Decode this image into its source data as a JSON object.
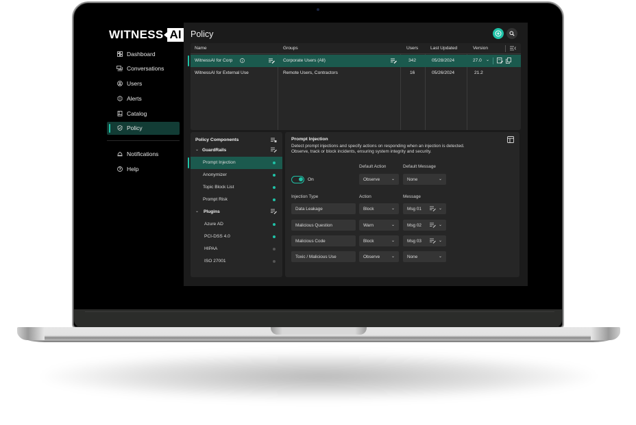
{
  "brand": {
    "word": "WITNESS",
    "box": "AI"
  },
  "sidebar": {
    "items": [
      {
        "label": "Dashboard",
        "icon": "dashboard-icon"
      },
      {
        "label": "Conversations",
        "icon": "conversations-icon"
      },
      {
        "label": "Users",
        "icon": "users-icon"
      },
      {
        "label": "Alerts",
        "icon": "alerts-icon"
      },
      {
        "label": "Catalog",
        "icon": "catalog-icon"
      },
      {
        "label": "Policy",
        "icon": "policy-shield-icon",
        "active": true
      }
    ],
    "secondary": [
      {
        "label": "Notifications",
        "icon": "bell-icon"
      },
      {
        "label": "Help",
        "icon": "help-icon"
      }
    ]
  },
  "header": {
    "title": "Policy",
    "add_icon": "plus-circle-icon",
    "search_icon": "search-icon"
  },
  "colors": {
    "accent": "#1fc2a7",
    "selected_row": "#1b5a4e",
    "panel": "#262626",
    "background": "#1b1b1b"
  },
  "policy_table": {
    "columns": [
      "Name",
      "Groups",
      "Users",
      "Last Updated",
      "Version"
    ],
    "rows": [
      {
        "name": "WitnessAI for Corp",
        "groups": "Corporate Users (All)",
        "users": "342",
        "last_updated": "05/28/2024",
        "version": "27.0",
        "selected": true
      },
      {
        "name": "WitnessAI for External Use",
        "groups": "Remote Users, Contractors",
        "users": "16",
        "last_updated": "05/26/2024",
        "version": "21.2",
        "selected": false
      }
    ]
  },
  "components": {
    "title": "Policy Components",
    "groups": [
      {
        "label": "GuardRails",
        "items": [
          {
            "label": "Prompt Injection",
            "enabled": true,
            "selected": true
          },
          {
            "label": "Anonymizer",
            "enabled": true
          },
          {
            "label": "Topic Block List",
            "enabled": true
          },
          {
            "label": "Prompt Risk",
            "enabled": true
          }
        ]
      },
      {
        "label": "Plugins",
        "items": [
          {
            "label": "Azure AD",
            "enabled": true
          },
          {
            "label": "PCI-DSS 4.0",
            "enabled": true
          },
          {
            "label": "HIPAA",
            "enabled": false
          },
          {
            "label": "ISO 27001",
            "enabled": false
          }
        ]
      }
    ]
  },
  "detail": {
    "title": "Prompt Injection",
    "description": "Detect prompt injections and specify actions on responding when an injection is detected. Observe, track or block incidents, ensuring system integrity and security.",
    "toggle_label": "On",
    "toggle_on": true,
    "default_action_label": "Default Action",
    "default_action": "Observe",
    "default_message_label": "Default Message",
    "default_message": "None",
    "col_type": "Injection Type",
    "col_action": "Action",
    "col_message": "Message",
    "rules": [
      {
        "type": "Data Leakage",
        "action": "Block",
        "message": "Msg 01",
        "editable": true
      },
      {
        "type": "Malicious Question",
        "action": "Warn",
        "message": "Msg 02",
        "editable": true
      },
      {
        "type": "Malicious Code",
        "action": "Block",
        "message": "Msg 03",
        "editable": true
      },
      {
        "type": "Toxic / Malicious Use",
        "action": "Observe",
        "message": "None",
        "editable": false
      }
    ]
  }
}
